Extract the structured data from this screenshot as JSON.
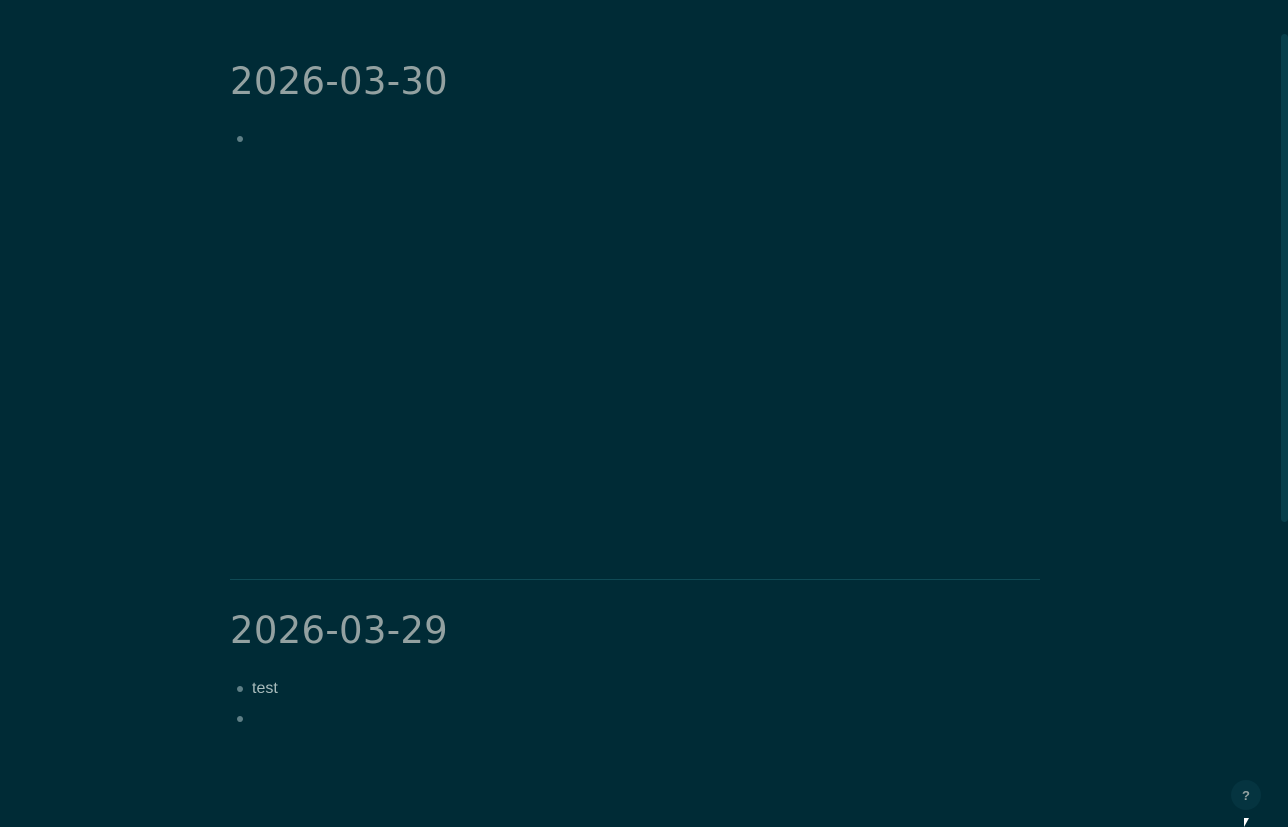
{
  "journals": [
    {
      "title": "2026-03-30",
      "blocks": [
        {
          "text": ""
        }
      ]
    },
    {
      "title": "2026-03-29",
      "blocks": [
        {
          "text": "test"
        },
        {
          "text": ""
        }
      ]
    }
  ],
  "help": {
    "label": "?"
  },
  "colors": {
    "background": "#002b36",
    "title": "#93a1a1",
    "bullet": "#5f7f86",
    "text": "#a9bcbc"
  }
}
